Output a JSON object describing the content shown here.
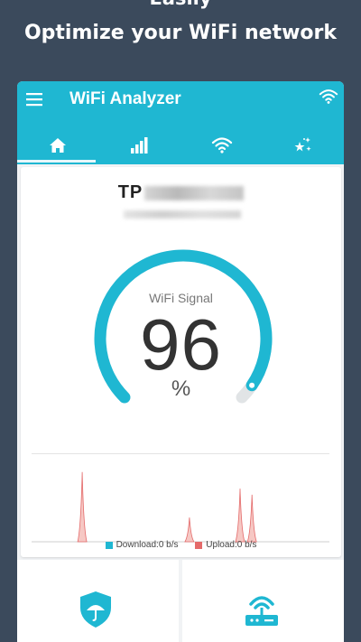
{
  "promo": {
    "top_text": "Easily",
    "title": "Optimize your WiFi network"
  },
  "app": {
    "title": "WiFi Analyzer",
    "accent_color": "#1fb7d2",
    "icons": {
      "menu": "hamburger-menu-icon",
      "status": "wifi-icon"
    }
  },
  "tabs": [
    {
      "icon": "home-icon",
      "active": true
    },
    {
      "icon": "signal-bars-icon",
      "active": false
    },
    {
      "icon": "wifi-icon",
      "active": false
    },
    {
      "icon": "sparkle-stars-icon",
      "active": false
    }
  ],
  "network": {
    "ssid_visible": "TP"
  },
  "signal": {
    "label": "WiFi Signal",
    "value": "96",
    "unit": "%",
    "percent": 96
  },
  "traffic": {
    "download_label": "Download:0 b/s",
    "upload_label": "Upload:0 b/s",
    "download_color": "#1fb7d2",
    "upload_color": "#e46a6a",
    "peaks": [
      {
        "position": 0.17,
        "height": 0.92
      },
      {
        "position": 0.53,
        "height": 0.32
      },
      {
        "position": 0.7,
        "height": 0.7
      },
      {
        "position": 0.74,
        "height": 0.62
      }
    ]
  },
  "bottom_cards": [
    {
      "icon": "shield-umbrella-icon"
    },
    {
      "icon": "router-icon"
    }
  ]
}
